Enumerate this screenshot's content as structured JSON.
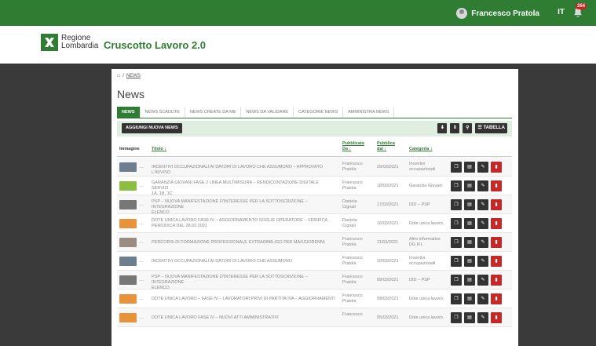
{
  "topbar": {
    "user_name": "Francesco Pratola",
    "lang": "IT",
    "notifications": "264"
  },
  "brand": {
    "logo_line1": "Regione",
    "logo_line2": "Lombardia",
    "app_title": "Cruscotto Lavoro 2.0"
  },
  "breadcrumb": {
    "link": "NEWS"
  },
  "page": {
    "title": "News"
  },
  "tabs": [
    "NEWS",
    "NEWS SCADUTE",
    "NEWS CREATE DA ME",
    "NEWS DA VALIDARE",
    "CATEGORIE NEWS",
    "AMMINISTRA NEWS"
  ],
  "toolbar": {
    "add_label": "AGGIUNGI NUOVA NEWS",
    "table_label": "TABELLA",
    "table_icon": "list-icon"
  },
  "columns": {
    "image": "Immagine",
    "title": "Titolo ↕",
    "pub_by_1": "Pubblicato",
    "pub_by_2": "Da ↕",
    "pub_from_1": "Pubblica",
    "pub_from_2": "dal ↕",
    "category": "Categoria ↕"
  },
  "rows": [
    {
      "thumb": "#6d7f8f",
      "title": "INCENTIVI OCCUPAZIONALI AI DATORI DI LAVORO CHE ASSUMONO – APPROVATO L'AVVISO",
      "title2": "",
      "author1": "Francesco",
      "author2": "Pratola",
      "date": "29/03/2021",
      "cat1": "Incentivi",
      "cat2": "occupazionali"
    },
    {
      "thumb": "#8cbf3f",
      "title": "GARANZIA GIOVANI FASE 2 LINEA MULTIMISURA – RENDICONTAZIONE DIGITALE SERVIZI",
      "title2": "1A, 1B, 1C",
      "author1": "Francesco",
      "author2": "Pratola",
      "date": "18/03/2021",
      "cat1": "Garanzia Giovani",
      "cat2": ""
    },
    {
      "thumb": "#777777",
      "title": "PSP – NUOVA MANIFESTAZIONE D'INTERESSE PER LA SOTTOSCRIZIONE – INTEGRAZIONE",
      "title2": "ELENCO",
      "author1": "Daniela",
      "author2": "Cignali",
      "date": "17/03/2021",
      "cat1": "DID – PSP",
      "cat2": ""
    },
    {
      "thumb": "#e8923a",
      "title": "DOTE UNICA LAVORO FASE IV – AGGIORNAMENTO SOGLIE OPERATORE – VERIFICA",
      "title2": "PERIODICA DEL 28.02.2021",
      "author1": "Daniela",
      "author2": "Cignali",
      "date": "16/03/2021",
      "cat1": "Dote unica lavoro",
      "cat2": ""
    },
    {
      "thumb": "#9a8c82",
      "title": "PERCORSI DI FORMAZIONE PROFESSIONALE EXTRAOBBLIGO PER MAGGIORENNI",
      "title2": "",
      "author1": "Francesco",
      "author2": "Pratola",
      "date": "11/03/2021",
      "cat1": "Altre informative",
      "cat2": "DG IFL"
    },
    {
      "thumb": "#6d7f8f",
      "title": "INCENTIVI OCCUPAZIONALI AI DATORI DI LAVORO CHE ASSUMONO",
      "title2": "",
      "author1": "Francesco",
      "author2": "Pratola",
      "date": "10/03/2021",
      "cat1": "Incentivi",
      "cat2": "occupazionali"
    },
    {
      "thumb": "#777777",
      "title": "PSP – NUOVA MANIFESTAZIONE D'INTERESSE PER LA SOTTOSCRIZIONE – INTEGRAZIONE",
      "title2": "ELENCO",
      "author1": "Francesco",
      "author2": "Pratola",
      "date": "09/03/2021",
      "cat1": "DID – PSP",
      "cat2": ""
    },
    {
      "thumb": "#e8923a",
      "title": "DOTE UNICA LAVORO – FASE IV – LAVORATORI PRIVI DI PARTITA IVA – AGGIORNAMENTI",
      "title2": "",
      "author1": "Francesco",
      "author2": "Pratola",
      "date": "09/03/2021",
      "cat1": "Dote unica lavoro",
      "cat2": ""
    },
    {
      "thumb": "#e8923a",
      "title": "DOTE UNICA LAVORO FASE IV – NUOVI ATTI AMMINISTRATIVI",
      "title2": "",
      "author1": "Francesco",
      "author2": "",
      "date": "05/03/2021",
      "cat1": "Dote unica lavoro",
      "cat2": ""
    }
  ],
  "colors": {
    "brand_green": "#2e7d32",
    "delete_red": "#c62828",
    "background": "#3a3a3a"
  }
}
